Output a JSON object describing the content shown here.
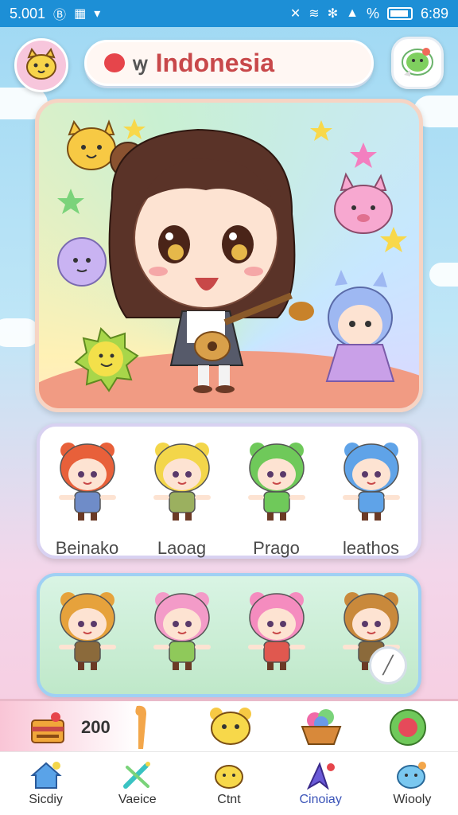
{
  "status_bar": {
    "time": "5.001",
    "right_time": "6:89",
    "signal_text": "%"
  },
  "header": {
    "title": "Indonesia",
    "glyph": "ꝡ"
  },
  "characters_row1": [
    {
      "name": "Beinako",
      "hair": "#e8603a",
      "outfit": "#6f8cc8"
    },
    {
      "name": "Laoag",
      "hair": "#f3d64a",
      "outfit": "#9bb05f"
    },
    {
      "name": "Prago",
      "hair": "#6fc95a",
      "outfit": "#6fc95a"
    },
    {
      "name": "leathos",
      "hair": "#5fa3e8",
      "outfit": "#5fa3e8"
    }
  ],
  "characters_row2": [
    {
      "hair": "#e6a23c",
      "outfit": "#8b6a3b"
    },
    {
      "hair": "#f39bc8",
      "outfit": "#8fc95a"
    },
    {
      "hair": "#f58cbf",
      "outfit": "#e0584f"
    },
    {
      "hair": "#c9893b",
      "outfit": "#8b6a3b"
    }
  ],
  "tray": {
    "coins": "200"
  },
  "nav": [
    {
      "label": "Sicdiy",
      "icon": "home-icon",
      "active": false
    },
    {
      "label": "Vaeice",
      "icon": "sword-icon",
      "active": false
    },
    {
      "label": "Ctnt",
      "icon": "cat-face-icon",
      "active": false
    },
    {
      "label": "Cinoiay",
      "icon": "arrow-icon",
      "active": true
    },
    {
      "label": "Wiooly",
      "icon": "blob-icon",
      "active": false
    }
  ],
  "colors": {
    "status_bar": "#1d8fd6",
    "title": "#c8484a",
    "nav_active": "#3b54b8"
  }
}
